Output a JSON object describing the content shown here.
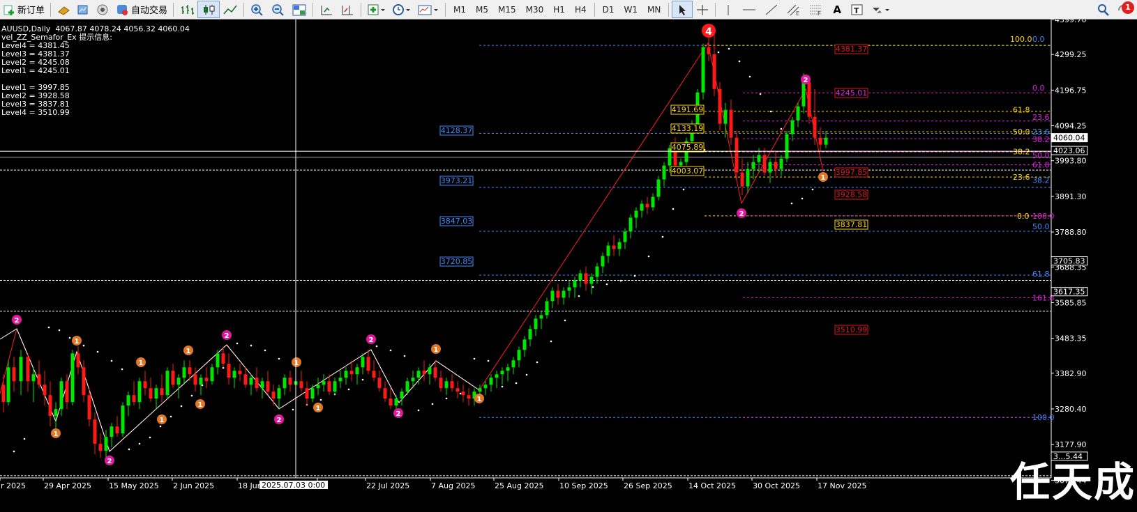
{
  "toolbar": {
    "new_order": "新订单",
    "auto_trade": "自动交易",
    "timeframes": [
      "M1",
      "M5",
      "M15",
      "M30",
      "H1",
      "H4",
      "D1",
      "W1",
      "MN"
    ],
    "text_tool": "A",
    "alert_count": "1",
    "icons": [
      "new-order-icon",
      "gold-icon",
      "market-watch-icon",
      "signal-icon",
      "auto-trade-icon",
      "bar-chart-icon",
      "candlestick-icon",
      "line-chart-icon",
      "zoom-in-icon",
      "zoom-out-icon",
      "tile-icon",
      "auto-scroll-icon",
      "chart-shift-icon",
      "indicators-icon",
      "periods-icon",
      "templates-icon",
      "cursor-icon",
      "crosshair-icon",
      "vertical-line-icon",
      "horizontal-line-icon",
      "trendline-icon",
      "equidistant-channel-icon",
      "fibonacci-icon",
      "text-icon",
      "label-icon",
      "arrows-icon",
      "search-icon",
      "notification-icon"
    ]
  },
  "chart": {
    "symbol_line": "AUUSD,Daily  4067.87 4078.24 4056.32 4060.04",
    "indicator_title": "vel_ZZ_Semafor_Ex 提示信息:",
    "upper_levels": [
      "Level4 = 4381.45",
      "Level3 = 4381.37",
      "Level2 = 4245.08",
      "Level1 = 4245.01"
    ],
    "lower_levels": [
      "Level1 = 3997.85",
      "Level2 = 3928.58",
      "Level3 = 3837.81",
      "Level4 = 3510.99"
    ],
    "price_axis": [
      "4399.70",
      "4299.25",
      "4196.75",
      "4094.25",
      "3993.80",
      "3891.30",
      "3788.80",
      "3688.35",
      "3585.85",
      "3483.35",
      "3382.90",
      "3280.40",
      "3177.90",
      "3075.44"
    ],
    "price_tags": {
      "current": "4060.04",
      "line1": "4023.06",
      "line2": "3705.83",
      "line3": "3617.35",
      "line4": "3...5.44"
    },
    "date_axis": [
      "r 2025",
      "29 Apr 2025",
      "15 May 2025",
      "2 Jun 2025",
      "18 Jun",
      "25",
      "22 Jul 2025",
      "7 Aug 2025",
      "25 Aug 2025",
      "10 Sep 2025",
      "26 Sep 2025",
      "14 Oct 2025",
      "30 Oct 2025",
      "17 Nov 2025"
    ],
    "crosshair_date": "2025.07.03 0:00",
    "blue_levels": [
      "4128.37",
      "3973.21",
      "3847.03",
      "3720.85"
    ],
    "yellow_boxes": [
      "4191.69",
      "4133.19",
      "4075.89",
      "4003.07"
    ],
    "red_boxes": [
      "4381.37",
      "4245.01",
      "3997.85",
      "3928.58",
      "3510.99"
    ],
    "yellow_box_right": "3837.81",
    "fib_yellow": [
      "100.0",
      "61.8",
      "50.0",
      "38.2",
      "23.6",
      "0.0"
    ],
    "fib_blue": [
      "0.0",
      "23.6",
      "38.2",
      "50.0",
      "61.8",
      "100.0"
    ],
    "fib_magenta": [
      "0.0",
      "23.6",
      "38.2",
      "50.0",
      "61.8",
      "100.0",
      "161.8"
    ],
    "semafor_4": "4",
    "semafor_2": "2",
    "semafor_1": "1"
  },
  "watermark": "任天成",
  "colors": {
    "up": "#00e600",
    "down": "#ff1a1a",
    "fib_yellow": "#ffd700",
    "fib_blue": "#3c8cff",
    "fib_magenta": "#e020e0",
    "semafor_2": "#e0189c",
    "semafor_1": "#e07828",
    "semafor_4": "#ff1a1a"
  }
}
